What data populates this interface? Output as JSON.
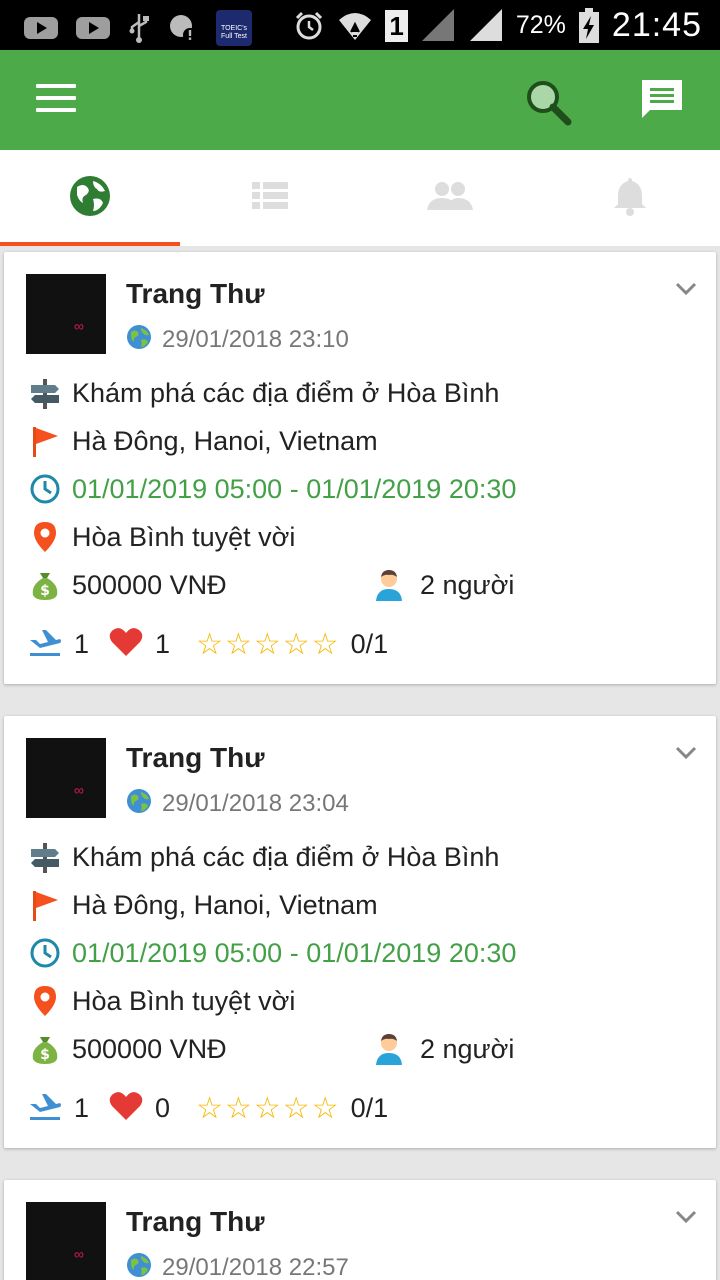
{
  "status_bar": {
    "toeic_label": "TOEIC's Full Test",
    "sim_slot": "1",
    "battery": "72%",
    "time": "21:45"
  },
  "app_bar": {
    "menu_icon": "hamburger-menu-icon",
    "search_icon": "search-icon",
    "chat_icon": "chat-icon"
  },
  "tabs": [
    {
      "icon": "globe-icon",
      "active": true
    },
    {
      "icon": "list-icon",
      "active": false
    },
    {
      "icon": "people-icon",
      "active": false
    },
    {
      "icon": "bell-icon",
      "active": false
    }
  ],
  "colors": {
    "app_bar": "#4caa48",
    "tab_indicator": "#f4511e",
    "date_range_text": "#43a047",
    "heart": "#e53935",
    "star": "#f5b800"
  },
  "posts": [
    {
      "author": "Trang Thư",
      "timestamp": "29/01/2018 23:10",
      "title": "Khám phá các địa điểm ở Hòa Bình",
      "start_location": "Hà Đông, Hanoi, Vietnam",
      "date_range": "01/01/2019 05:00 - 01/01/2019 20:30",
      "destination": "Hòa Bình tuyệt vời",
      "cost": "500000 VNĐ",
      "people": "2 người",
      "trips": "1",
      "likes": "1",
      "rating": "0/1"
    },
    {
      "author": "Trang Thư",
      "timestamp": "29/01/2018 23:04",
      "title": "Khám phá các địa điểm ở Hòa Bình",
      "start_location": "Hà Đông, Hanoi, Vietnam",
      "date_range": "01/01/2019 05:00 - 01/01/2019 20:30",
      "destination": "Hòa Bình tuyệt vời",
      "cost": "500000 VNĐ",
      "people": "2 người",
      "trips": "1",
      "likes": "0",
      "rating": "0/1"
    },
    {
      "author": "Trang Thư",
      "timestamp": "29/01/2018 22:57"
    }
  ]
}
